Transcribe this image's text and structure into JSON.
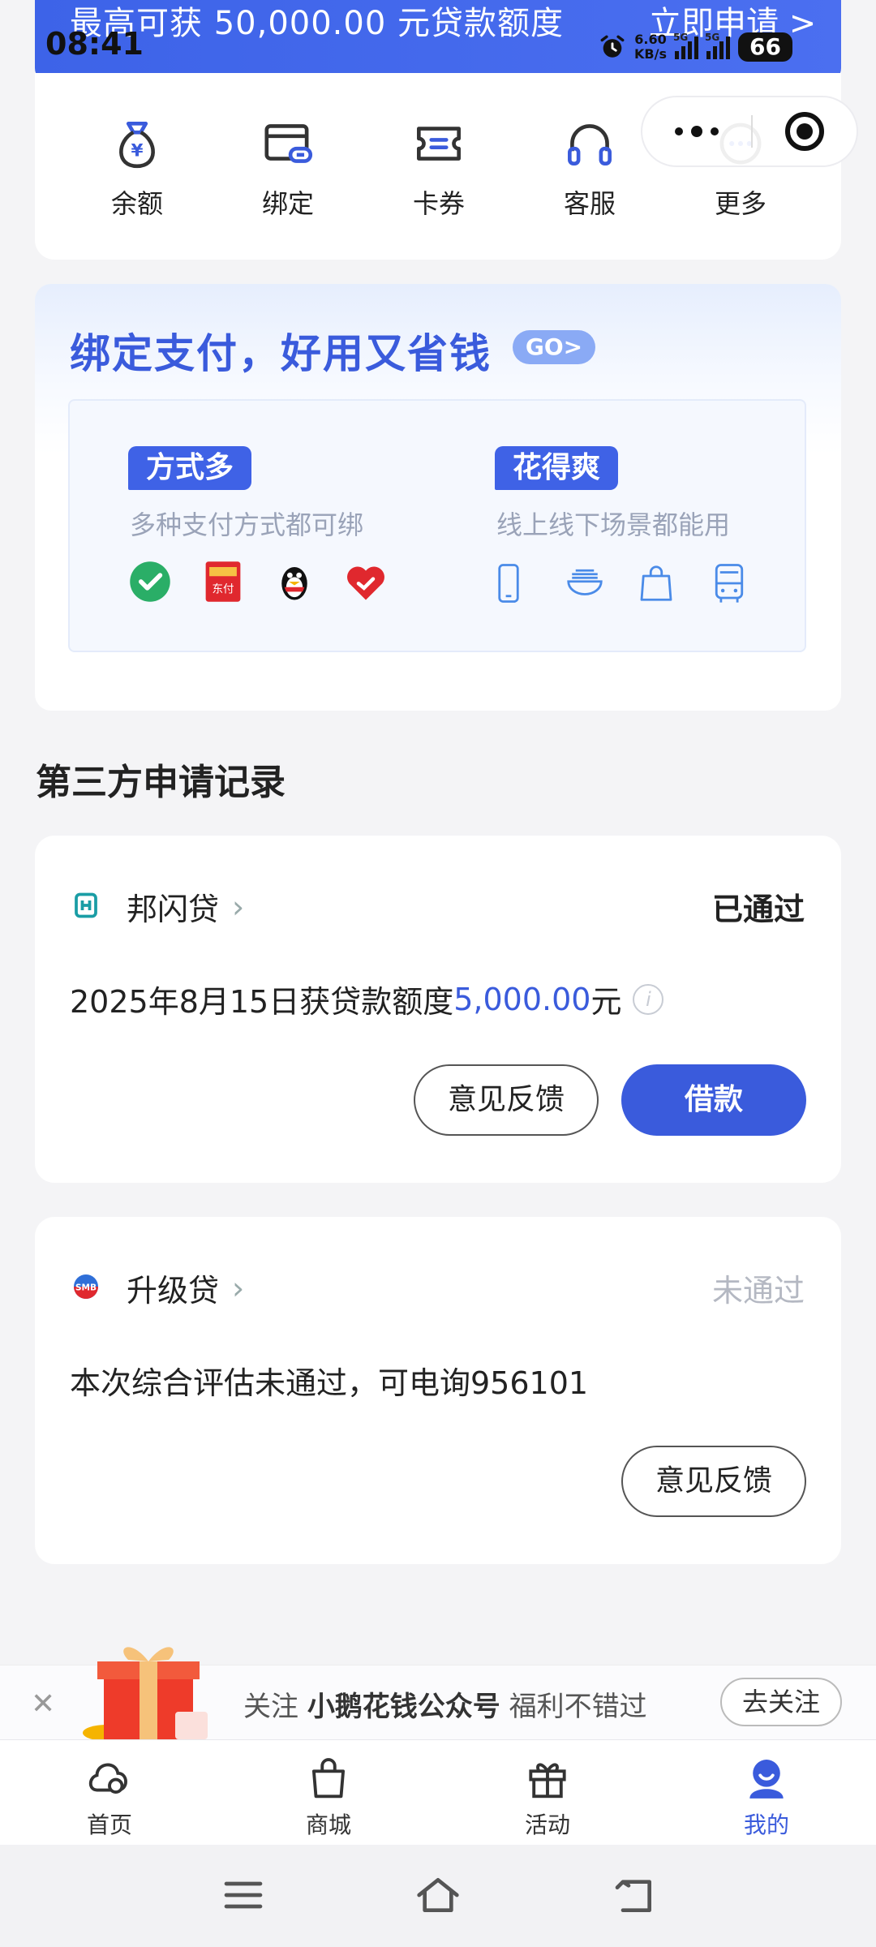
{
  "status_bar": {
    "time": "08:41",
    "net_speed_value": "6.60",
    "net_speed_unit": "KB/s",
    "sim1": "5G",
    "sim2": "5G",
    "battery": "66"
  },
  "banner": {
    "text": "最高可获  50,000.00  元贷款额度",
    "action": "立即申请 >"
  },
  "quick_menu": {
    "items": [
      {
        "label": "余额",
        "icon": "money-bag-icon"
      },
      {
        "label": "绑定",
        "icon": "card-link-icon"
      },
      {
        "label": "卡券",
        "icon": "ticket-icon"
      },
      {
        "label": "客服",
        "icon": "headset-icon"
      },
      {
        "label": "更多",
        "icon": "more-icon"
      }
    ]
  },
  "promo": {
    "title": "绑定支付，好用又省钱",
    "go": "GO>",
    "left_tag": "方式多",
    "left_sub": "多种支付方式都可绑",
    "left_icons": [
      "wechat-icon",
      "dongfu-icon",
      "qq-penguin-icon",
      "heart-shield-icon"
    ],
    "right_tag": "花得爽",
    "right_sub": "线上线下场景都能用",
    "right_icons": [
      "phone-icon",
      "food-bowl-icon",
      "shopping-bag-icon",
      "bus-icon"
    ]
  },
  "records": {
    "section_title": "第三方申请记录",
    "items": [
      {
        "name": "邦闪贷",
        "status": "已通过",
        "desc_prefix": "2025年8月15日获贷款额度",
        "amount": "5,000.00",
        "desc_suffix": "元",
        "btn_feedback": "意见反馈",
        "btn_borrow": "借款"
      },
      {
        "name": "升级贷",
        "status": "未通过",
        "desc": "本次综合评估未通过，可电询956101",
        "btn_feedback": "意见反馈"
      }
    ]
  },
  "follow": {
    "prefix": "关注 ",
    "account": "小鹅花钱公众号",
    "suffix": " 福利不错过",
    "button": "去关注"
  },
  "tabbar": {
    "items": [
      {
        "label": "首页",
        "icon": "home-icon"
      },
      {
        "label": "商城",
        "icon": "shop-bag-icon"
      },
      {
        "label": "活动",
        "icon": "gift-icon"
      },
      {
        "label": "我的",
        "icon": "profile-icon"
      }
    ],
    "active_color": "#3a5bdc"
  },
  "colors": {
    "accent": "#3a5bdc",
    "banner": "#4267ec",
    "fail_text": "#b4b8c2"
  }
}
